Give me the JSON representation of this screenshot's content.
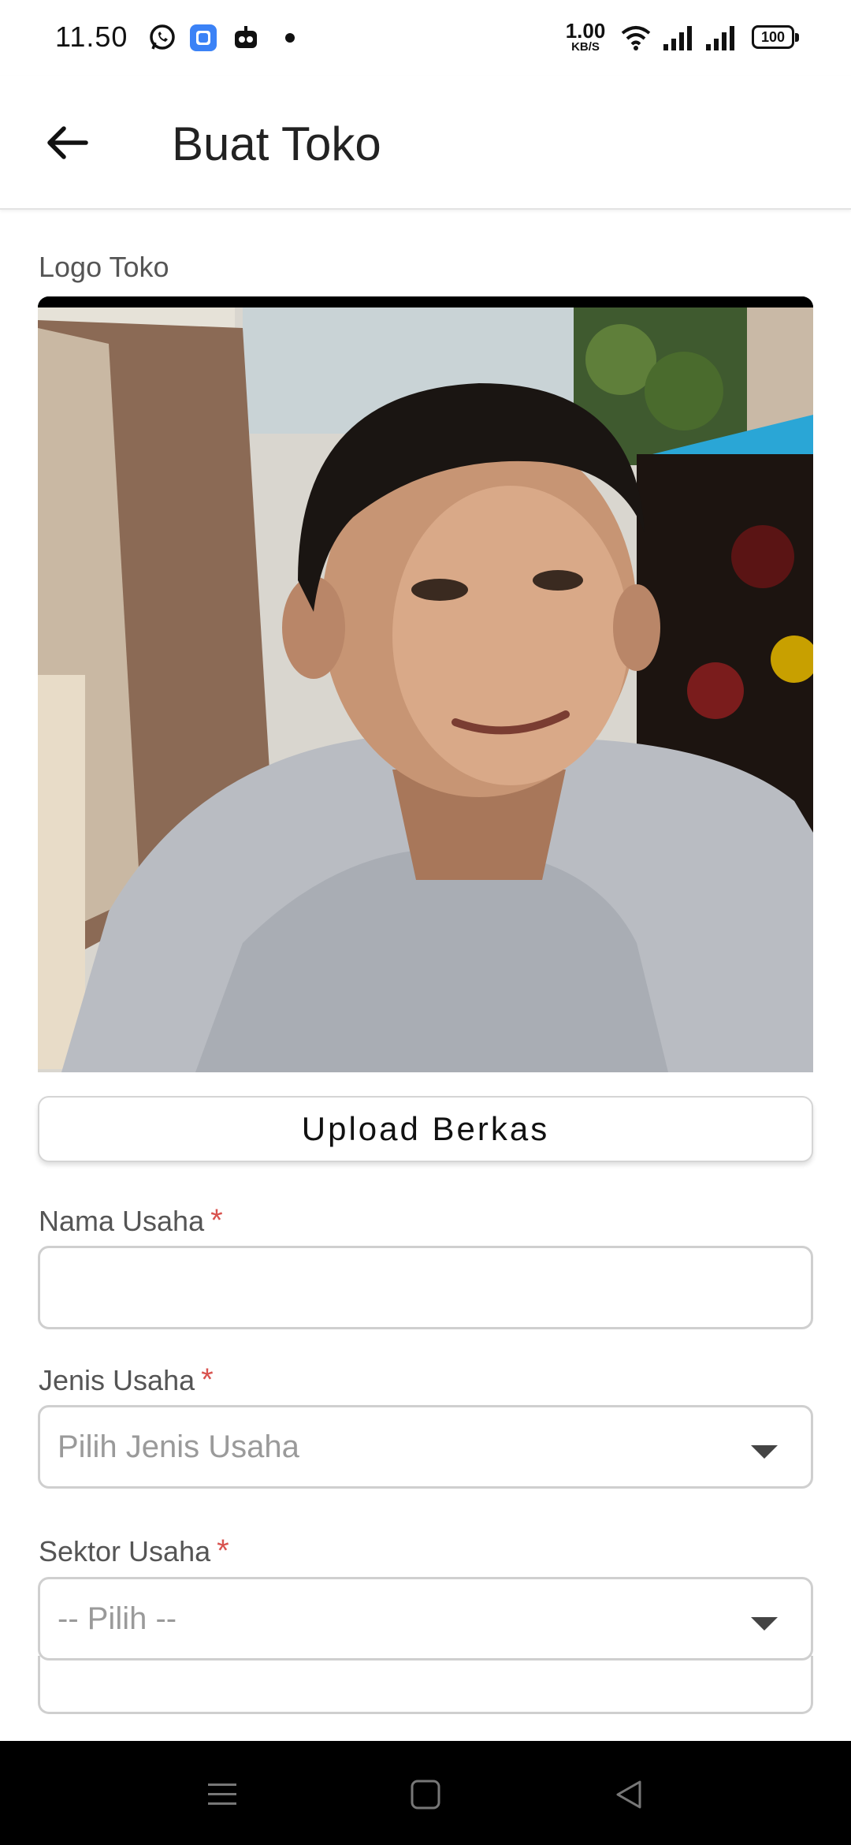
{
  "status_bar": {
    "time": "11.50",
    "net_speed": "1.00",
    "net_unit": "KB/S",
    "battery": "100",
    "icons": [
      "whatsapp-icon",
      "app-icon",
      "bot-icon",
      "notification-dot",
      "wifi-icon",
      "signal-icon",
      "signal-icon",
      "battery-icon"
    ]
  },
  "app_bar": {
    "back_icon": "arrow-left-icon",
    "title": "Buat Toko"
  },
  "form": {
    "logo_label": "Logo Toko",
    "upload_button": "Upload Berkas",
    "name_label": "Nama Usaha",
    "name_value": "",
    "type_label": "Jenis Usaha",
    "type_placeholder": "Pilih Jenis Usaha",
    "sector_label": "Sektor Usaha",
    "sector_placeholder": "-- Pilih --",
    "required_mark": "*"
  },
  "colors": {
    "required": "#d9534f",
    "border": "#cfcfcf",
    "navbar": "#000000"
  },
  "nav_bar": {
    "icons": [
      "menu-icon",
      "home-square-icon",
      "back-triangle-icon"
    ]
  }
}
